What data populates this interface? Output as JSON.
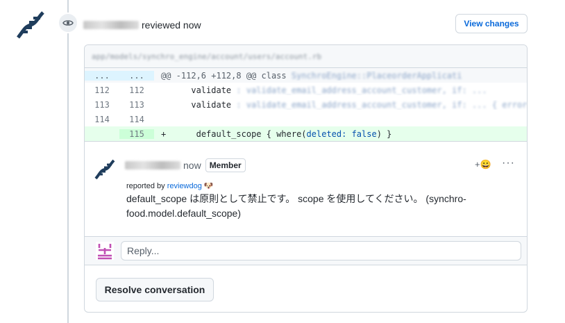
{
  "review": {
    "username": "",
    "action": "reviewed",
    "time": "now",
    "view_changes_label": "View changes"
  },
  "file": {
    "path": "app/models/synchro_engine/account/users/account.rb"
  },
  "diff": {
    "hunk": {
      "old_marker": "...",
      "new_marker": "...",
      "text": "@@ -112,6 +112,8 @@ class",
      "context_blurred": "SynchroEngine::PlaceorderApplicati"
    },
    "lines": [
      {
        "old": "112",
        "new": "112",
        "sign": "",
        "code": "validate",
        "rest": ": validate_email_address_account_customer, if: ..."
      },
      {
        "old": "113",
        "new": "113",
        "sign": "",
        "code": "validate",
        "rest": ": validate_email_address_account_customer, if: ... { errors"
      },
      {
        "old": "114",
        "new": "114",
        "sign": "",
        "code": "",
        "rest": ""
      }
    ],
    "added": {
      "old": "",
      "new": "115",
      "sign": "+",
      "code_pre": "default_scope { where(",
      "kw1": "deleted:",
      "sp": " ",
      "kw2": "false",
      "code_post": ") }"
    }
  },
  "comment": {
    "username": "",
    "time": "now",
    "badge": "Member",
    "reaction_label": "+😀",
    "more_label": "···",
    "reported_prefix": "reported by",
    "reporter": "reviewdog",
    "reporter_emoji": "🐶",
    "body": "default_scope は原則として禁止です。 scope を使用してください。 (synchro-food.model.default_scope)"
  },
  "reply": {
    "placeholder": "Reply..."
  },
  "resolve_label": "Resolve conversation",
  "colors": {
    "accent": "#0969da",
    "added_bg": "#e6ffec",
    "hunk_num_bg": "#ddf4ff"
  }
}
